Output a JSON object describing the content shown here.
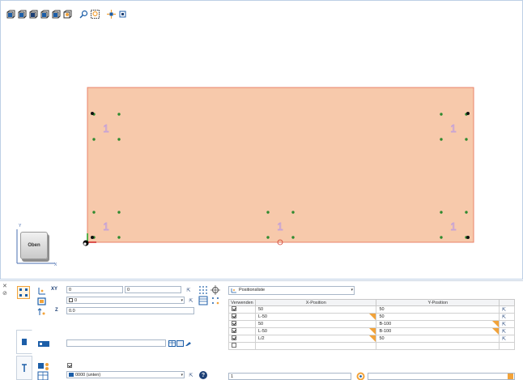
{
  "toolbar": {
    "icons": [
      "view-front-icon",
      "view-back-icon",
      "view-top-icon",
      "view-left-icon",
      "view-right-icon",
      "view-iso-icon",
      "zoom-all-icon",
      "zoom-window-icon",
      "pan-icon",
      "settings-view-icon"
    ]
  },
  "view": {
    "plate_color": "#f7c9ab",
    "plate_border": "#e8826a",
    "label_color": "#c7a3d6",
    "dot_color": "#2f8a2f",
    "position_label": "1",
    "navcube_label": "Oben",
    "axis_y": "Y",
    "axis_x": "X"
  },
  "properties": {
    "xy_label": "XY",
    "x_value": "0",
    "y_value": "0",
    "layer_value": "0",
    "z_label": "Z",
    "z_value": "0.0",
    "text_value": "",
    "material_value": "0000 (unten)",
    "checkbox_checked": true,
    "help_symbol": "?"
  },
  "table": {
    "select_value": "Positionsliste",
    "headers": [
      "Verwenden",
      "X-Position",
      "Y-Position"
    ],
    "rows": [
      {
        "use": true,
        "x": "50",
        "x_flag": false,
        "y": "50",
        "y_flag": false
      },
      {
        "use": true,
        "x": "L-50",
        "x_flag": true,
        "y": "50",
        "y_flag": false
      },
      {
        "use": true,
        "x": "50",
        "x_flag": false,
        "y": "B-100",
        "y_flag": true
      },
      {
        "use": true,
        "x": "L-50",
        "x_flag": true,
        "y": "B-100",
        "y_flag": true
      },
      {
        "use": true,
        "x": "L/2",
        "x_flag": true,
        "y": "50",
        "y_flag": false
      },
      {
        "use": false,
        "x": "",
        "x_flag": false,
        "y": "",
        "y_flag": false
      }
    ],
    "footer_value": "1"
  },
  "accent": {
    "orange": "#f2a33a",
    "blue": "#1c5ea8"
  }
}
